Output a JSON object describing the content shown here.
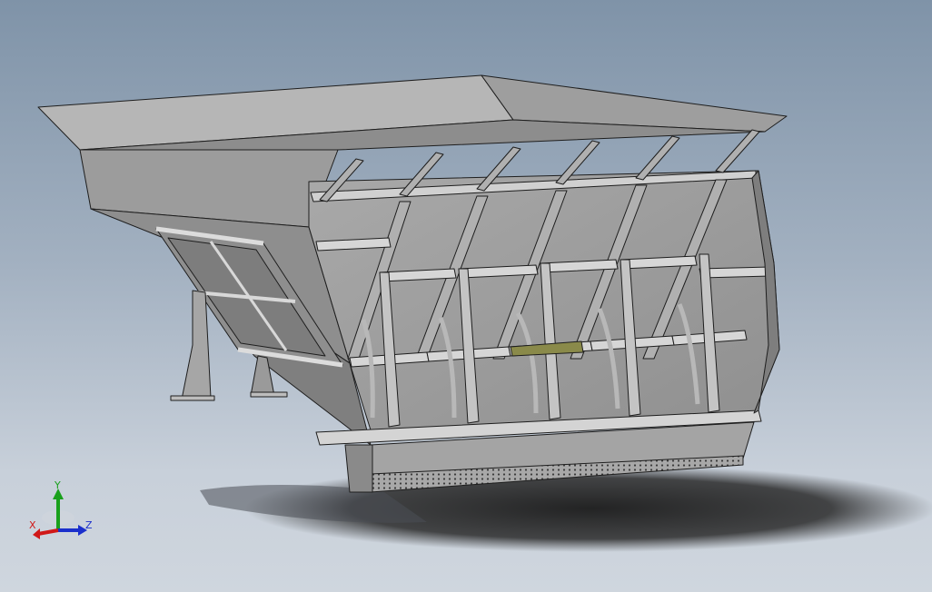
{
  "viewport": {
    "background_top": "#7f93a8",
    "background_bottom": "#cfd6de"
  },
  "model": {
    "subject": "hopper-assembly",
    "body_color": "#9a9a9a",
    "edge_color": "#1e1e1e",
    "accent_color": "#8a8a4a"
  },
  "triad": {
    "x_label": "X",
    "y_label": "Y",
    "z_label": "Z",
    "x_color": "#d01818",
    "y_color": "#19a01c",
    "z_color": "#1a2fcc"
  }
}
